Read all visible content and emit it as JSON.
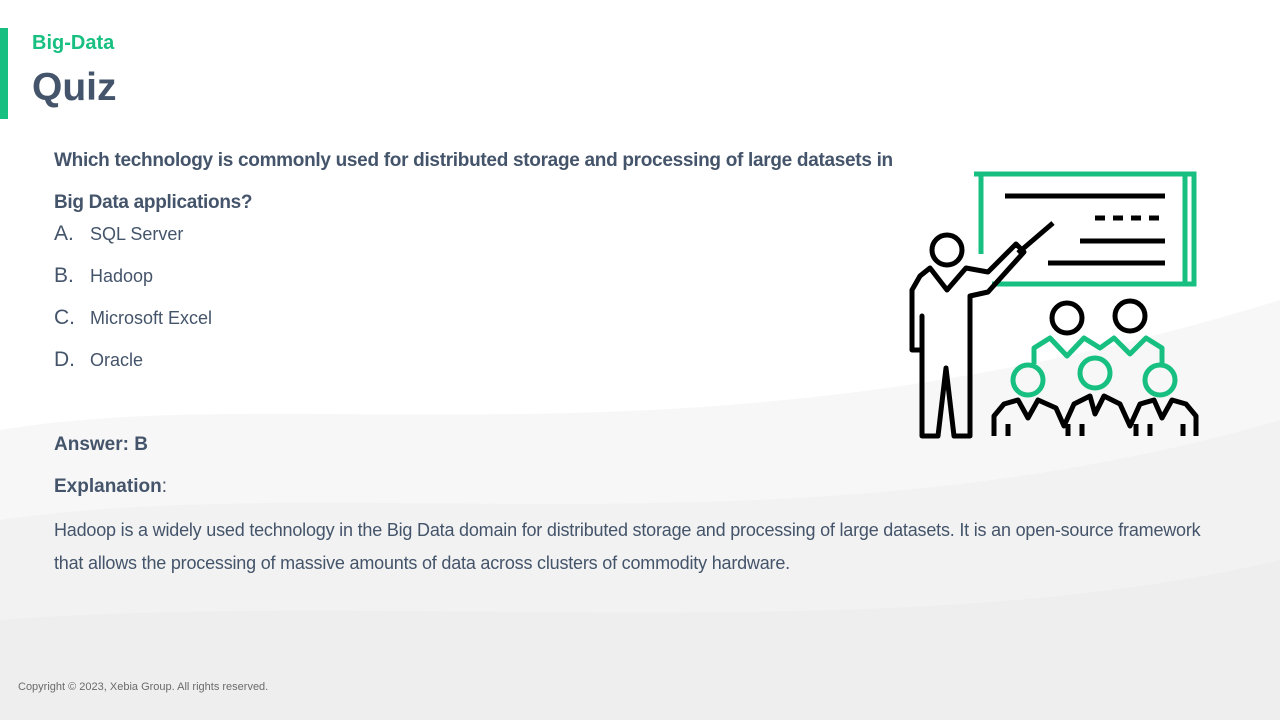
{
  "header": {
    "subtitle": "Big-Data",
    "title": "Quiz"
  },
  "quiz": {
    "question": "Which technology is commonly used for distributed storage and processing of large datasets in Big Data applications?",
    "options": [
      {
        "letter": "A.",
        "text": "SQL Server"
      },
      {
        "letter": "B.",
        "text": "Hadoop"
      },
      {
        "letter": "C.",
        "text": "Microsoft Excel"
      },
      {
        "letter": "D.",
        "text": "Oracle"
      }
    ],
    "answer": "Answer: B",
    "explanation_label": "Explanation",
    "explanation_suffix": ":",
    "explanation_text": "Hadoop is a widely used technology in the Big Data domain for distributed storage and processing of large datasets. It is an open-source framework that allows the processing of massive amounts of data across clusters of commodity hardware."
  },
  "illustration": {
    "icon": "classroom-presentation-icon"
  },
  "footer": {
    "copyright": "Copyright © 2023, Xebia Group. All rights reserved."
  },
  "colors": {
    "accent": "#17c081",
    "text": "#44546a"
  }
}
